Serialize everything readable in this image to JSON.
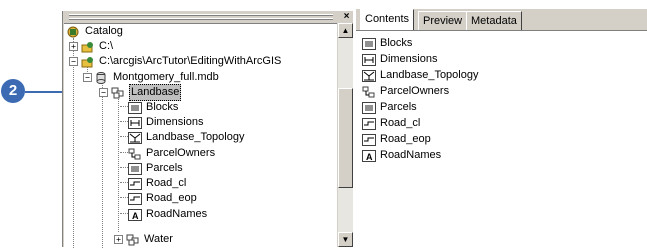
{
  "callout": {
    "number": "2"
  },
  "tree": {
    "close_glyph": "×",
    "items": [
      {
        "label": "Catalog",
        "icon": "catalog-icon"
      },
      {
        "label": "C:\\",
        "icon": "drive-connection-icon"
      },
      {
        "label": "C:\\arcgis\\ArcTutor\\EditingWithArcGIS",
        "icon": "folder-connection-icon"
      },
      {
        "label": "Montgomery_full.mdb",
        "icon": "geodatabase-icon"
      },
      {
        "label": "Landbase",
        "icon": "feature-dataset-icon",
        "selected": true
      },
      {
        "label": "Blocks",
        "icon": "polygon-feature-class-icon"
      },
      {
        "label": "Dimensions",
        "icon": "dimension-feature-class-icon"
      },
      {
        "label": "Landbase_Topology",
        "icon": "topology-icon"
      },
      {
        "label": "ParcelOwners",
        "icon": "relationship-class-icon"
      },
      {
        "label": "Parcels",
        "icon": "polygon-feature-class-icon"
      },
      {
        "label": "Road_cl",
        "icon": "line-feature-class-icon"
      },
      {
        "label": "Road_eop",
        "icon": "line-feature-class-icon"
      },
      {
        "label": "RoadNames",
        "icon": "annotation-feature-class-icon"
      },
      {
        "label": "Water",
        "icon": "feature-dataset-icon"
      }
    ]
  },
  "tabs": [
    {
      "label": "Contents",
      "active": true
    },
    {
      "label": "Preview",
      "active": false
    },
    {
      "label": "Metadata",
      "active": false
    }
  ],
  "contents": [
    {
      "label": "Blocks",
      "icon": "polygon-feature-class-icon"
    },
    {
      "label": "Dimensions",
      "icon": "dimension-feature-class-icon"
    },
    {
      "label": "Landbase_Topology",
      "icon": "topology-icon"
    },
    {
      "label": "ParcelOwners",
      "icon": "relationship-class-icon"
    },
    {
      "label": "Parcels",
      "icon": "polygon-feature-class-icon"
    },
    {
      "label": "Road_cl",
      "icon": "line-feature-class-icon"
    },
    {
      "label": "Road_eop",
      "icon": "line-feature-class-icon"
    },
    {
      "label": "RoadNames",
      "icon": "annotation-feature-class-icon"
    }
  ],
  "scrollbar": {
    "up_glyph": "▲",
    "down_glyph": "▼"
  },
  "colors": {
    "callout": "#3c6bb4",
    "window_face": "#d4d0c8",
    "selection": "#c0c0c0"
  }
}
